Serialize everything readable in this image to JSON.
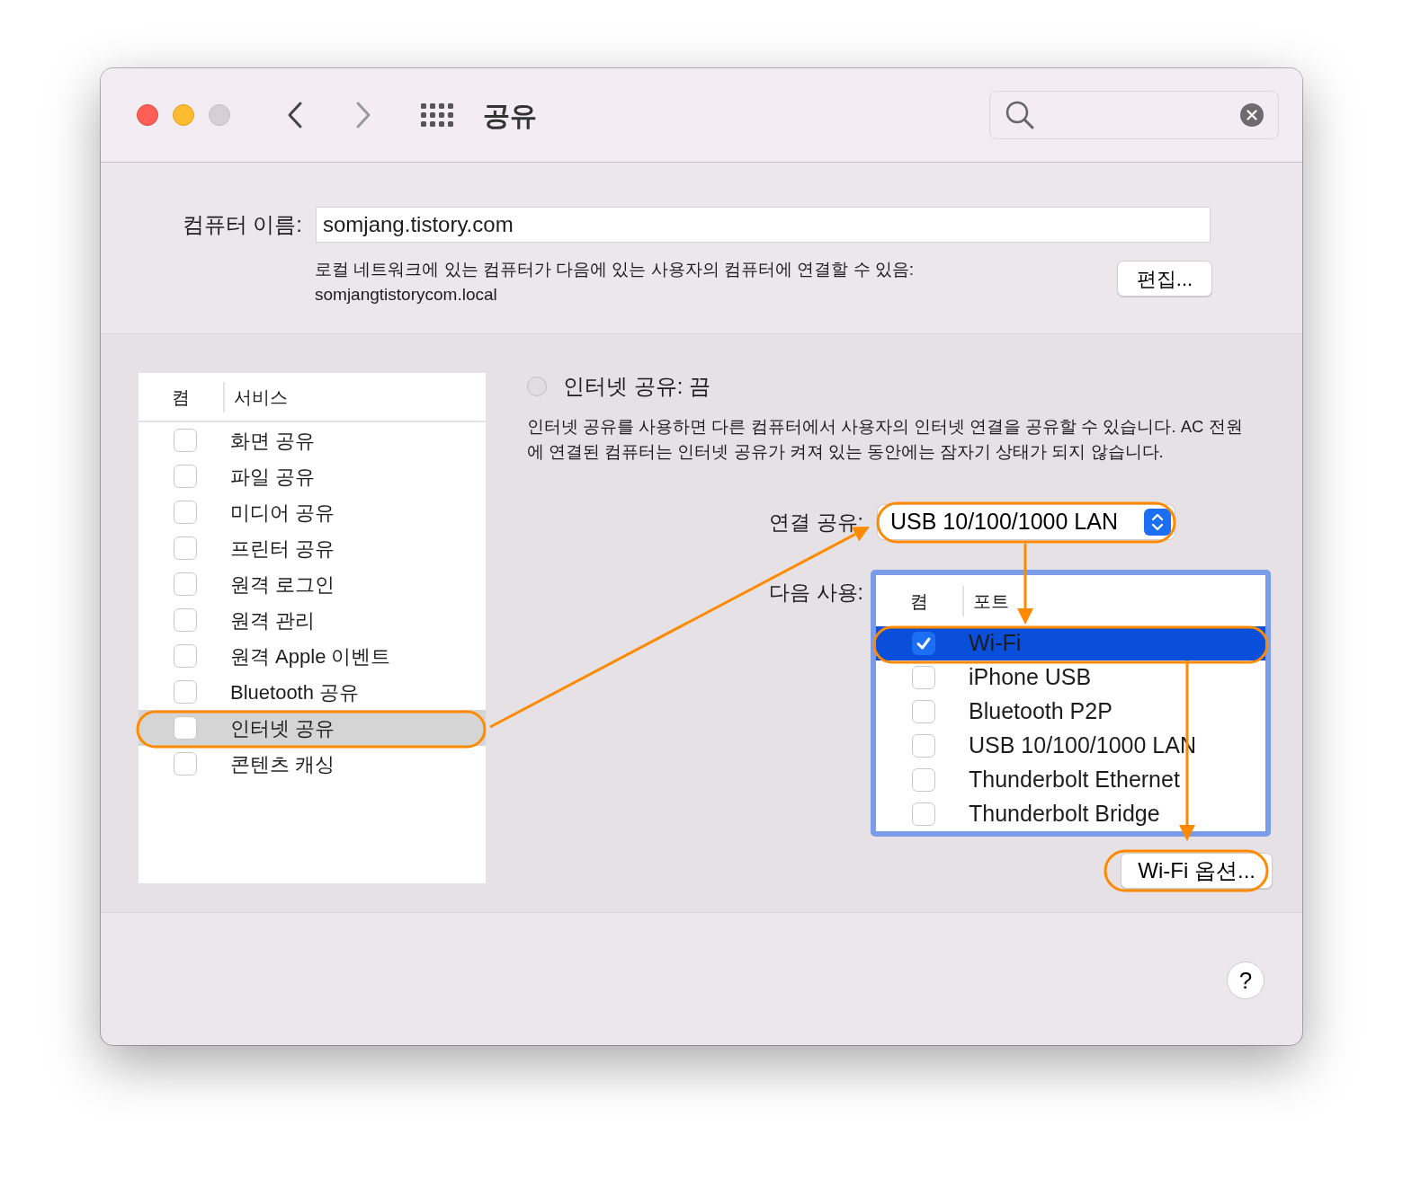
{
  "window": {
    "title": "공유"
  },
  "computer_name": {
    "label": "컴퓨터 이름:",
    "value": "somjang.tistory.com"
  },
  "local_access": {
    "text": "로컬 네트워크에 있는 컴퓨터가 다음에 있는 사용자의 컴퓨터에 연결할 수 있음:",
    "address": "somjangtistorycom.local",
    "edit_button": "편집..."
  },
  "services": {
    "columns": [
      "켬",
      "서비스"
    ],
    "rows": [
      {
        "name": "화면 공유",
        "on": false,
        "selected": false
      },
      {
        "name": "파일 공유",
        "on": false,
        "selected": false
      },
      {
        "name": "미디어 공유",
        "on": false,
        "selected": false
      },
      {
        "name": "프린터 공유",
        "on": false,
        "selected": false
      },
      {
        "name": "원격 로그인",
        "on": false,
        "selected": false
      },
      {
        "name": "원격 관리",
        "on": false,
        "selected": false
      },
      {
        "name": "원격 Apple 이벤트",
        "on": false,
        "selected": false
      },
      {
        "name": "Bluetooth 공유",
        "on": false,
        "selected": false
      },
      {
        "name": "인터넷 공유",
        "on": false,
        "selected": true
      },
      {
        "name": "콘텐츠 캐싱",
        "on": false,
        "selected": false
      }
    ]
  },
  "detail": {
    "status": {
      "label": "인터넷 공유: 끔",
      "on": false
    },
    "description": "인터넷 공유를 사용하면 다른 컴퓨터에서 사용자의 인터넷 연결을 공유할 수 있습니다. AC 전원에 연결된 컴퓨터는 인터넷 공유가 켜져 있는 동안에는 잠자기 상태가 되지 않습니다.",
    "share_from": {
      "label": "연결 공유:",
      "value": "USB 10/100/1000 LAN"
    },
    "share_to": {
      "label": "다음 사용:",
      "columns": [
        "켬",
        "포트"
      ],
      "rows": [
        {
          "name": "Wi-Fi",
          "on": true,
          "selected": true
        },
        {
          "name": "iPhone USB",
          "on": false,
          "selected": false
        },
        {
          "name": "Bluetooth P2P",
          "on": false,
          "selected": false
        },
        {
          "name": "USB 10/100/1000 LAN",
          "on": false,
          "selected": false
        },
        {
          "name": "Thunderbolt Ethernet",
          "on": false,
          "selected": false
        },
        {
          "name": "Thunderbolt Bridge",
          "on": false,
          "selected": false
        }
      ]
    },
    "options_button": "Wi-Fi 옵션..."
  },
  "help_button": "?"
}
